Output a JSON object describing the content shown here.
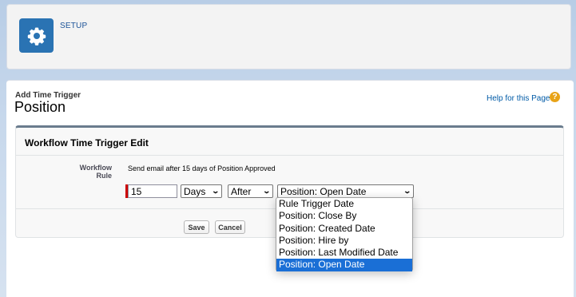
{
  "header": {
    "setup_label": "SETUP",
    "icon": "gear-icon",
    "tile_color": "#2a73b3"
  },
  "page": {
    "subtitle": "Add Time Trigger",
    "title": "Position",
    "help_link": "Help for this Page",
    "help_icon": "question-icon"
  },
  "form": {
    "section_title": "Workflow Time Trigger Edit",
    "rule_label": "Workflow Rule",
    "rule_text": "Send email after 15 days of Position Approved",
    "number_value": "15",
    "unit_selected": "Days",
    "direction_selected": "After",
    "date_selected": "Position: Open Date",
    "save_label": "Save",
    "cancel_label": "Cancel"
  },
  "dropdown": {
    "options": [
      "Rule Trigger Date",
      "Position: Close By",
      "Position: Created Date",
      "Position: Hire by",
      "Position: Last Modified Date",
      "Position: Open Date"
    ],
    "selected_index": 5,
    "highlight_color": "#1a6fd6"
  }
}
